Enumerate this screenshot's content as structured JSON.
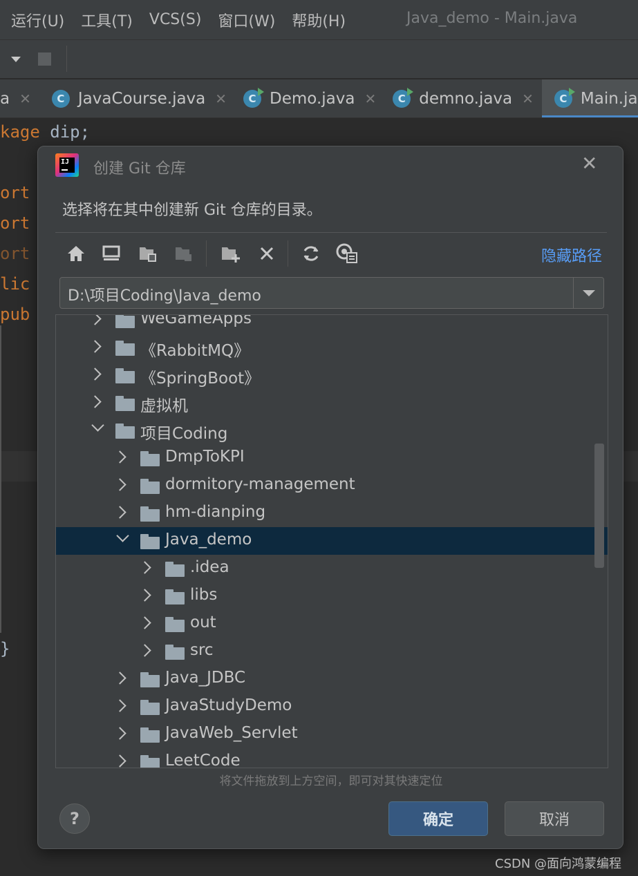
{
  "menubar": {
    "items": [
      "运行(U)",
      "工具(T)",
      "VCS(S)",
      "窗口(W)",
      "帮助(H)"
    ],
    "window_title": "Java_demo - Main.java"
  },
  "tabs": [
    {
      "label": "a",
      "icon": "class-icon",
      "active": false,
      "partial": true
    },
    {
      "label": "JavaCourse.java",
      "icon": "class-icon",
      "active": false
    },
    {
      "label": "Demo.java",
      "icon": "runnable-class-icon",
      "active": false
    },
    {
      "label": "demno.java",
      "icon": "runnable-class-icon",
      "active": false
    },
    {
      "label": "Main.java",
      "icon": "runnable-class-icon",
      "active": true
    }
  ],
  "editor": {
    "lines": [
      {
        "kw": "kage",
        "rest": " dip;"
      },
      {
        "kw": "ort",
        "rest": ""
      },
      {
        "kw": "ort",
        "rest": ""
      },
      {
        "kw": "ort",
        "rest": ""
      },
      {
        "kw": "lic",
        "rest": ""
      },
      {
        "kw": "pub",
        "rest": ""
      },
      {
        "kw": "",
        "rest": "}"
      }
    ]
  },
  "dialog": {
    "title": "创建 Git 仓库",
    "prompt": "选择将在其中创建新 Git 仓库的目录。",
    "hide_path_label": "隐藏路径",
    "path_value": "D:\\项目Coding\\Java_demo",
    "toolbar_icons": [
      "home-icon",
      "desktop-icon",
      "project-folder-icon",
      "module-folder-icon",
      "new-folder-icon",
      "delete-icon",
      "refresh-icon",
      "show-hidden-icon"
    ],
    "tree": [
      {
        "label": "WeGameApps",
        "level": 0,
        "expanded": false
      },
      {
        "label": "《RabbitMQ》",
        "level": 0,
        "expanded": false
      },
      {
        "label": "《SpringBoot》",
        "level": 0,
        "expanded": false
      },
      {
        "label": "虚拟机",
        "level": 0,
        "expanded": false
      },
      {
        "label": "项目Coding",
        "level": 0,
        "expanded": true
      },
      {
        "label": "DmpToKPI",
        "level": 1,
        "expanded": false
      },
      {
        "label": "dormitory-management",
        "level": 1,
        "expanded": false
      },
      {
        "label": "hm-dianping",
        "level": 1,
        "expanded": false
      },
      {
        "label": "Java_demo",
        "level": 1,
        "expanded": true,
        "selected": true
      },
      {
        "label": ".idea",
        "level": 2,
        "expanded": false
      },
      {
        "label": "libs",
        "level": 2,
        "expanded": false
      },
      {
        "label": "out",
        "level": 2,
        "expanded": false
      },
      {
        "label": "src",
        "level": 2,
        "expanded": false
      },
      {
        "label": "Java_JDBC",
        "level": 1,
        "expanded": false
      },
      {
        "label": "JavaStudyDemo",
        "level": 1,
        "expanded": false
      },
      {
        "label": "JavaWeb_Servlet",
        "level": 1,
        "expanded": false
      },
      {
        "label": "LeetCode",
        "level": 1,
        "expanded": false
      }
    ],
    "drag_hint": "将文件拖放到上方空间，即可对其快速定位",
    "help_label": "?",
    "ok_label": "确定",
    "cancel_label": "取消"
  },
  "watermark": "CSDN @面向鸿蒙编程",
  "colors": {
    "accent_link": "#589df6",
    "selection": "#0d293e",
    "primary_button": "#365880",
    "keyword": "#cc7832"
  }
}
